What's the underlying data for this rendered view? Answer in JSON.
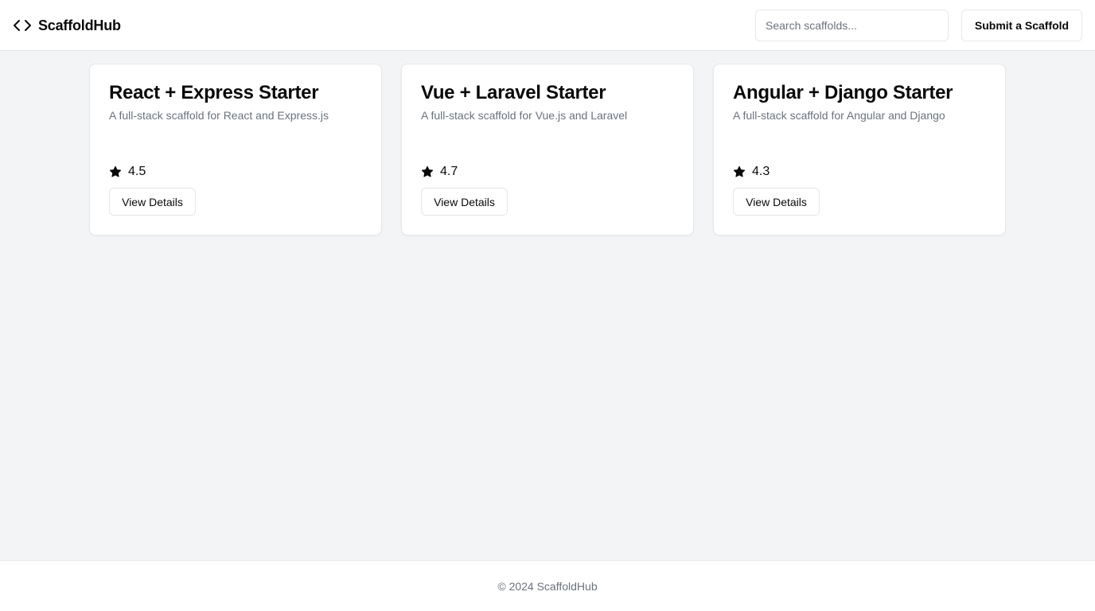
{
  "header": {
    "brand_name": "ScaffoldHub",
    "brand_icon": "code-icon",
    "search": {
      "placeholder": "Search scaffolds...",
      "value": ""
    },
    "submit_label": "Submit a Scaffold"
  },
  "cards": [
    {
      "title": "React + Express Starter",
      "description": "A full-stack scaffold for React and Express.js",
      "rating": "4.5",
      "button_label": "View Details"
    },
    {
      "title": "Vue + Laravel Starter",
      "description": "A full-stack scaffold for Vue.js and Laravel",
      "rating": "4.7",
      "button_label": "View Details"
    },
    {
      "title": "Angular + Django Starter",
      "description": "A full-stack scaffold for Angular and Django",
      "rating": "4.3",
      "button_label": "View Details"
    }
  ],
  "footer": {
    "text": "© 2024 ScaffoldHub"
  },
  "colors": {
    "page_background": "#f3f4f6",
    "surface": "#ffffff",
    "border": "#e5e7eb",
    "text_primary": "#0a0a0a",
    "text_muted": "#6b7280"
  }
}
